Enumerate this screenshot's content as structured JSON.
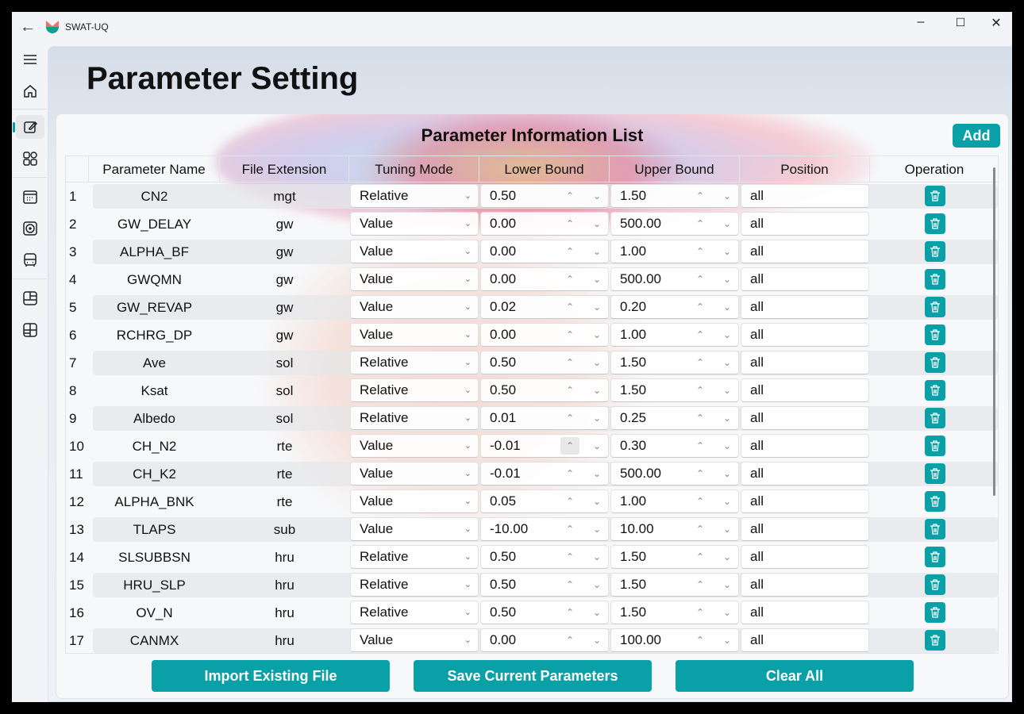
{
  "app": {
    "title": "SWAT-UQ"
  },
  "page": {
    "title": "Parameter Setting"
  },
  "card": {
    "title": "Parameter Information List",
    "add_label": "Add"
  },
  "colors": {
    "accent": "#0aa0a8"
  },
  "table": {
    "headers": [
      "Parameter Name",
      "File Extension",
      "Tuning Mode",
      "Lower Bound",
      "Upper Bound",
      "Position",
      "Operation"
    ],
    "rows": [
      {
        "n": "1",
        "name": "CN2",
        "ext": "mgt",
        "mode": "Relative",
        "lb": "0.50",
        "ub": "1.50",
        "pos": "all"
      },
      {
        "n": "2",
        "name": "GW_DELAY",
        "ext": "gw",
        "mode": "Value",
        "lb": "0.00",
        "ub": "500.00",
        "pos": "all"
      },
      {
        "n": "3",
        "name": "ALPHA_BF",
        "ext": "gw",
        "mode": "Value",
        "lb": "0.00",
        "ub": "1.00",
        "pos": "all"
      },
      {
        "n": "4",
        "name": "GWQMN",
        "ext": "gw",
        "mode": "Value",
        "lb": "0.00",
        "ub": "500.00",
        "pos": "all"
      },
      {
        "n": "5",
        "name": "GW_REVAP",
        "ext": "gw",
        "mode": "Value",
        "lb": "0.02",
        "ub": "0.20",
        "pos": "all"
      },
      {
        "n": "6",
        "name": "RCHRG_DP",
        "ext": "gw",
        "mode": "Value",
        "lb": "0.00",
        "ub": "1.00",
        "pos": "all"
      },
      {
        "n": "7",
        "name": "Ave",
        "ext": "sol",
        "mode": "Relative",
        "lb": "0.50",
        "ub": "1.50",
        "pos": "all"
      },
      {
        "n": "8",
        "name": "Ksat",
        "ext": "sol",
        "mode": "Relative",
        "lb": "0.50",
        "ub": "1.50",
        "pos": "all"
      },
      {
        "n": "9",
        "name": "Albedo",
        "ext": "sol",
        "mode": "Relative",
        "lb": "0.01",
        "ub": "0.25",
        "pos": "all"
      },
      {
        "n": "10",
        "name": "CH_N2",
        "ext": "rte",
        "mode": "Value",
        "lb": "-0.01",
        "ub": "0.30",
        "pos": "all"
      },
      {
        "n": "11",
        "name": "CH_K2",
        "ext": "rte",
        "mode": "Value",
        "lb": "-0.01",
        "ub": "500.00",
        "pos": "all"
      },
      {
        "n": "12",
        "name": "ALPHA_BNK",
        "ext": "rte",
        "mode": "Value",
        "lb": "0.05",
        "ub": "1.00",
        "pos": "all"
      },
      {
        "n": "13",
        "name": "TLAPS",
        "ext": "sub",
        "mode": "Value",
        "lb": "-10.00",
        "ub": "10.00",
        "pos": "all"
      },
      {
        "n": "14",
        "name": "SLSUBBSN",
        "ext": "hru",
        "mode": "Relative",
        "lb": "0.50",
        "ub": "1.50",
        "pos": "all"
      },
      {
        "n": "15",
        "name": "HRU_SLP",
        "ext": "hru",
        "mode": "Relative",
        "lb": "0.50",
        "ub": "1.50",
        "pos": "all"
      },
      {
        "n": "16",
        "name": "OV_N",
        "ext": "hru",
        "mode": "Relative",
        "lb": "0.50",
        "ub": "1.50",
        "pos": "all"
      },
      {
        "n": "17",
        "name": "CANMX",
        "ext": "hru",
        "mode": "Value",
        "lb": "0.00",
        "ub": "100.00",
        "pos": "all"
      }
    ]
  },
  "buttons": {
    "import": "Import Existing File",
    "save": "Save Current Parameters",
    "clear": "Clear All"
  }
}
